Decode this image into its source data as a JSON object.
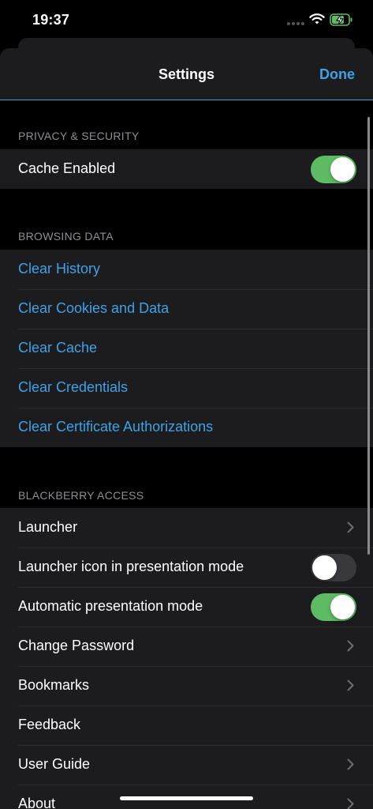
{
  "status_bar": {
    "time": "19:37"
  },
  "nav": {
    "title": "Settings",
    "done_label": "Done"
  },
  "sections": {
    "privacy": {
      "header": "PRIVACY & SECURITY",
      "cache_enabled": {
        "label": "Cache Enabled",
        "on": true
      }
    },
    "browsing": {
      "header": "BROWSING DATA",
      "items": [
        "Clear History",
        "Clear Cookies and Data",
        "Clear Cache",
        "Clear Credentials",
        "Clear Certificate Authorizations"
      ]
    },
    "access": {
      "header": "BLACKBERRY ACCESS",
      "launcher": "Launcher",
      "launcher_icon": {
        "label": "Launcher icon in presentation mode",
        "on": false
      },
      "auto_presentation": {
        "label": "Automatic presentation mode",
        "on": true
      },
      "change_password": "Change Password",
      "bookmarks": "Bookmarks",
      "feedback": "Feedback",
      "user_guide": "User Guide",
      "about": "About"
    }
  },
  "colors": {
    "accent": "#3ea2e6",
    "toggle_on": "#5dbb63",
    "toggle_off": "#39393d",
    "row_bg": "#1c1c1e"
  }
}
